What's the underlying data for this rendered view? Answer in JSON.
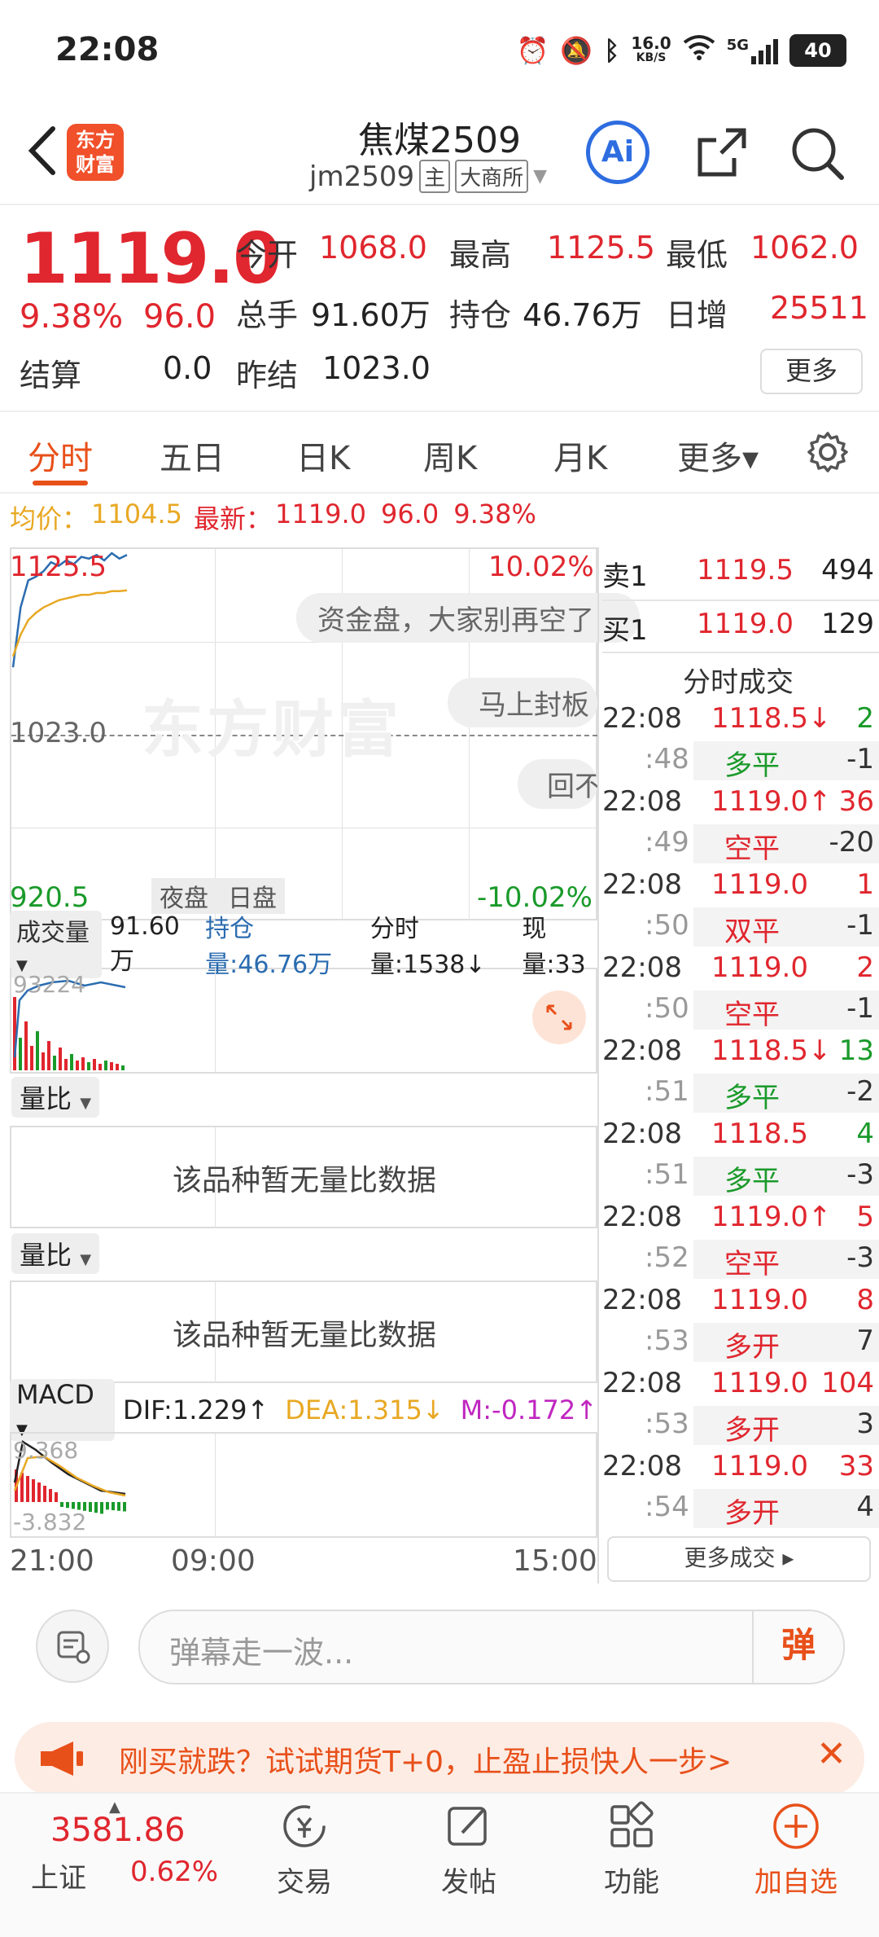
{
  "status_bar": {
    "time": "22:08",
    "net_speed_value": "16.0",
    "net_speed_unit": "KB/S",
    "network": "5G",
    "battery": "40"
  },
  "header": {
    "title": "焦煤2509",
    "code": "jm2509",
    "tag_main": "主",
    "tag_exchange": "大商所",
    "logo_line1": "东方",
    "logo_line2": "财富",
    "ai_label": "Ai"
  },
  "quote": {
    "price": "1119.0",
    "change_pct": "9.38%",
    "change": "96.0",
    "open_label": "今开",
    "open": "1068.0",
    "high_label": "最高",
    "high": "1125.5",
    "low_label": "最低",
    "low": "1062.0",
    "volume_label": "总手",
    "volume": "91.60万",
    "oi_label": "持仓",
    "oi": "46.76万",
    "daily_inc_label": "日增",
    "daily_inc": "25511",
    "settle_label": "结算",
    "settle": "0.0",
    "prev_settle_label": "昨结",
    "prev_settle": "1023.0",
    "more_label": "更多"
  },
  "tabs": [
    {
      "label": "分时",
      "active": true
    },
    {
      "label": "五日"
    },
    {
      "label": "日K"
    },
    {
      "label": "周K"
    },
    {
      "label": "月K"
    },
    {
      "label": "更多▾"
    }
  ],
  "avg_line": {
    "avg_label": "均价：",
    "avg": "1104.5",
    "latest_label": "最新：",
    "latest": "1119.0",
    "latest_chg": "96.0",
    "latest_pct": "9.38%"
  },
  "main_chart": {
    "max_label": "1125.5",
    "max_pct": "10.02%",
    "mid_label": "1023.0",
    "min_label": "920.5",
    "min_pct": "-10.02%",
    "night_label": "夜盘",
    "day_label": "日盘",
    "watermark": "东方财富",
    "danmu": [
      "资金盘，大家别再空了",
      "马上封板",
      "回不"
    ]
  },
  "volume_chart": {
    "selector": "成交量",
    "total": "91.60万",
    "oi": "持仓量:46.76万",
    "tick_vol": "分时量:1538↓",
    "now_vol": "现量:33",
    "max_label": "93224"
  },
  "ratio_panels": [
    {
      "selector": "量比",
      "empty_text": "该品种暂无量比数据"
    },
    {
      "selector": "量比",
      "empty_text": "该品种暂无量比数据"
    }
  ],
  "macd": {
    "selector": "MACD",
    "dif": "DIF:1.229↑",
    "dea": "DEA:1.315↓",
    "m": "M:-0.172↑",
    "top_label": "9.368",
    "bottom_label": "-3.832"
  },
  "time_axis": [
    "21:00",
    "09:00",
    "15:00"
  ],
  "order_book": {
    "sell": {
      "label": "卖1",
      "price": "1119.5",
      "qty": "494"
    },
    "buy": {
      "label": "买1",
      "price": "1119.0",
      "qty": "129"
    }
  },
  "trades_title": "分时成交",
  "trades": [
    {
      "time": "22:08",
      "price": "1118.5↓",
      "qty": "2",
      "sec": ":48",
      "type": "多平",
      "delta": "-1",
      "pcolor": "red",
      "qcolor": "green",
      "tcolor": "green"
    },
    {
      "time": "22:08",
      "price": "1119.0↑",
      "qty": "36",
      "sec": ":49",
      "type": "空平",
      "delta": "-20",
      "pcolor": "red",
      "qcolor": "red",
      "tcolor": "red"
    },
    {
      "time": "22:08",
      "price": "1119.0",
      "qty": "1",
      "sec": ":50",
      "type": "双平",
      "delta": "-1",
      "pcolor": "red",
      "qcolor": "red",
      "tcolor": "red"
    },
    {
      "time": "22:08",
      "price": "1119.0",
      "qty": "2",
      "sec": ":50",
      "type": "空平",
      "delta": "-1",
      "pcolor": "red",
      "qcolor": "red",
      "tcolor": "red"
    },
    {
      "time": "22:08",
      "price": "1118.5↓",
      "qty": "13",
      "sec": ":51",
      "type": "多平",
      "delta": "-2",
      "pcolor": "red",
      "qcolor": "green",
      "tcolor": "green"
    },
    {
      "time": "22:08",
      "price": "1118.5",
      "qty": "4",
      "sec": ":51",
      "type": "多平",
      "delta": "-3",
      "pcolor": "red",
      "qcolor": "green",
      "tcolor": "green"
    },
    {
      "time": "22:08",
      "price": "1119.0↑",
      "qty": "5",
      "sec": ":52",
      "type": "空平",
      "delta": "-3",
      "pcolor": "red",
      "qcolor": "red",
      "tcolor": "red"
    },
    {
      "time": "22:08",
      "price": "1119.0",
      "qty": "8",
      "sec": ":53",
      "type": "多开",
      "delta": "7",
      "pcolor": "red",
      "qcolor": "red",
      "tcolor": "red"
    },
    {
      "time": "22:08",
      "price": "1119.0",
      "qty": "104",
      "sec": ":53",
      "type": "多开",
      "delta": "3",
      "pcolor": "red",
      "qcolor": "red",
      "tcolor": "red"
    },
    {
      "time": "22:08",
      "price": "1119.0",
      "qty": "33",
      "sec": ":54",
      "type": "多开",
      "delta": "4",
      "pcolor": "red",
      "qcolor": "red",
      "tcolor": "red"
    }
  ],
  "more_trades": "更多成交 ▸",
  "danmu_input": {
    "placeholder": "弹幕走一波...",
    "send_label": "弹"
  },
  "promo": {
    "text": "刚买就跌？试试期货T+0，止盈止损快人一步>"
  },
  "bottom_nav": {
    "index_value": "3581.86",
    "index_name": "上证",
    "index_pct": "0.62%",
    "items": [
      {
        "label": "交易",
        "icon": "trade-icon"
      },
      {
        "label": "发帖",
        "icon": "post-icon"
      },
      {
        "label": "功能",
        "icon": "grid-icon"
      },
      {
        "label": "加自选",
        "icon": "add-watch-icon"
      }
    ]
  },
  "chart_data": {
    "type": "line",
    "series": [
      {
        "name": "价格",
        "x": [
          0,
          2,
          4,
          6,
          8,
          10,
          12,
          14,
          16,
          18,
          20,
          22,
          24,
          26,
          28,
          30
        ],
        "y": [
          1062,
          1095,
          1110,
          1112,
          1115,
          1120,
          1118,
          1121,
          1119,
          1123,
          1122,
          1124,
          1121,
          1125,
          1122,
          1124
        ]
      },
      {
        "name": "均价",
        "x": [
          0,
          2,
          4,
          6,
          8,
          10,
          12,
          14,
          16,
          18,
          20,
          22,
          24,
          26,
          28,
          30
        ],
        "y": [
          1068,
          1080,
          1088,
          1092,
          1095,
          1097,
          1099,
          1100,
          1101,
          1102,
          1102,
          1103,
          1103,
          1104,
          1104,
          1104.5
        ]
      }
    ],
    "ylim": [
      920.5,
      1125.5
    ]
  }
}
